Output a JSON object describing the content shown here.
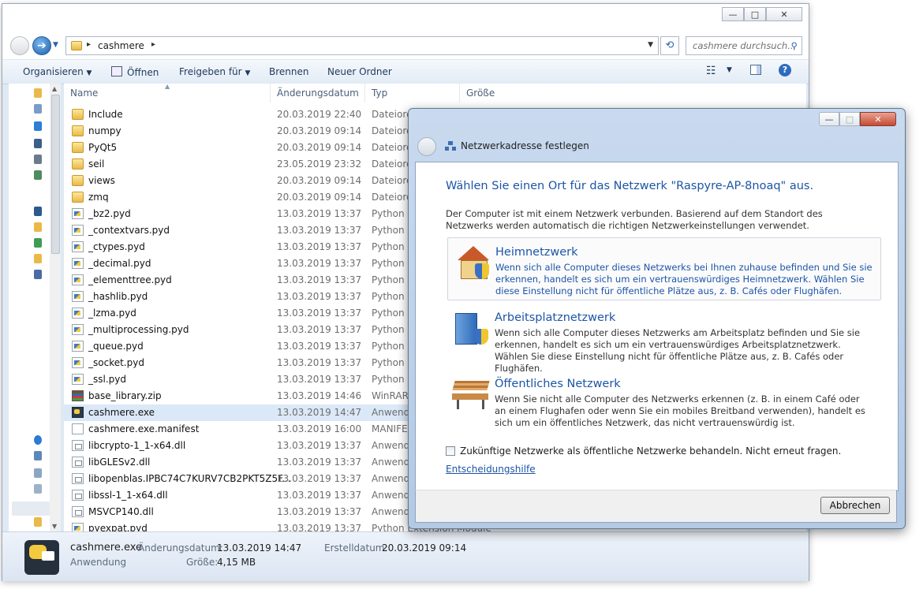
{
  "explorer": {
    "window_buttons": {
      "minimize": "—",
      "maximize": "□",
      "close": "✕"
    },
    "breadcrumb": {
      "arrow": "▸",
      "current": "cashmere"
    },
    "search": {
      "placeholder": "cashmere durchsuch..."
    },
    "toolbar": {
      "organize": "Organisieren",
      "open": "Öffnen",
      "share": "Freigeben für",
      "burn": "Brennen",
      "new_folder": "Neuer Ordner"
    },
    "columns": {
      "name": "Name",
      "date": "Änderungsdatum",
      "type": "Typ",
      "size": "Größe"
    },
    "files": [
      {
        "name": "Include",
        "date": "20.03.2019 22:40",
        "type": "Dateiordner",
        "icon": "folder"
      },
      {
        "name": "numpy",
        "date": "20.03.2019 09:14",
        "type": "Dateiordner",
        "icon": "folder"
      },
      {
        "name": "PyQt5",
        "date": "20.03.2019 09:14",
        "type": "Dateiordner",
        "icon": "folder"
      },
      {
        "name": "seil",
        "date": "23.05.2019 23:32",
        "type": "Dateiordner",
        "icon": "folder"
      },
      {
        "name": "views",
        "date": "20.03.2019 09:14",
        "type": "Dateiordner",
        "icon": "folder"
      },
      {
        "name": "zmq",
        "date": "20.03.2019 09:14",
        "type": "Dateiordner",
        "icon": "folder"
      },
      {
        "name": "_bz2.pyd",
        "date": "13.03.2019 13:37",
        "type": "Python Extension Module",
        "icon": "pyd"
      },
      {
        "name": "_contextvars.pyd",
        "date": "13.03.2019 13:37",
        "type": "Python Extension Module",
        "icon": "pyd"
      },
      {
        "name": "_ctypes.pyd",
        "date": "13.03.2019 13:37",
        "type": "Python Extension Module",
        "icon": "pyd"
      },
      {
        "name": "_decimal.pyd",
        "date": "13.03.2019 13:37",
        "type": "Python Extension Module",
        "icon": "pyd"
      },
      {
        "name": "_elementtree.pyd",
        "date": "13.03.2019 13:37",
        "type": "Python Extension Module",
        "icon": "pyd"
      },
      {
        "name": "_hashlib.pyd",
        "date": "13.03.2019 13:37",
        "type": "Python Extension Module",
        "icon": "pyd"
      },
      {
        "name": "_lzma.pyd",
        "date": "13.03.2019 13:37",
        "type": "Python Extension Module",
        "icon": "pyd"
      },
      {
        "name": "_multiprocessing.pyd",
        "date": "13.03.2019 13:37",
        "type": "Python Extension Module",
        "icon": "pyd"
      },
      {
        "name": "_queue.pyd",
        "date": "13.03.2019 13:37",
        "type": "Python Extension Module",
        "icon": "pyd"
      },
      {
        "name": "_socket.pyd",
        "date": "13.03.2019 13:37",
        "type": "Python Extension Module",
        "icon": "pyd"
      },
      {
        "name": "_ssl.pyd",
        "date": "13.03.2019 13:37",
        "type": "Python Extension Module",
        "icon": "pyd"
      },
      {
        "name": "base_library.zip",
        "date": "13.03.2019 14:46",
        "type": "WinRAR-ZIP-Archiv",
        "icon": "zip"
      },
      {
        "name": "cashmere.exe",
        "date": "13.03.2019 14:47",
        "type": "Anwendung",
        "icon": "exe"
      },
      {
        "name": "cashmere.exe.manifest",
        "date": "13.03.2019 16:00",
        "type": "MANIFEST-Datei",
        "icon": "txt"
      },
      {
        "name": "libcrypto-1_1-x64.dll",
        "date": "13.03.2019 13:37",
        "type": "Anwendungserweiterung",
        "icon": "dll"
      },
      {
        "name": "libGLESv2.dll",
        "date": "13.03.2019 13:37",
        "type": "Anwendungserweiterung",
        "icon": "dll"
      },
      {
        "name": "libopenblas.IPBC74C7KURV7CB2PKT5Z5F...",
        "date": "13.03.2019 13:37",
        "type": "Anwendungserweiterung",
        "icon": "dll"
      },
      {
        "name": "libssl-1_1-x64.dll",
        "date": "13.03.2019 13:37",
        "type": "Anwendungserweiterung",
        "icon": "dll"
      },
      {
        "name": "MSVCP140.dll",
        "date": "13.03.2019 13:37",
        "type": "Anwendungserweiterung",
        "icon": "dll"
      },
      {
        "name": "pyexpat.pyd",
        "date": "13.03.2019 13:37",
        "type": "Python Extension Module",
        "icon": "pyd"
      }
    ],
    "selected_file": "cashmere.exe",
    "details": {
      "name": "cashmere.exe",
      "modified_label": "Änderungsdatum:",
      "modified_value": "13.03.2019 14:47",
      "created_label": "Erstelldatum:",
      "created_value": "20.03.2019 09:14",
      "kind": "Anwendung",
      "size_label": "Größe:",
      "size_value": "4,15 MB"
    }
  },
  "dialog": {
    "title": "Netzwerkadresse festlegen",
    "heading": "Wählen Sie einen Ort für das Netzwerk \"Raspyre-AP-8noaq\" aus.",
    "intro": "Der Computer ist mit einem Netzwerk verbunden. Basierend auf dem Standort des Netzwerks werden automatisch die richtigen Netzwerkeinstellungen verwendet.",
    "options": [
      {
        "title": "Heimnetzwerk",
        "desc": "Wenn sich alle Computer dieses Netzwerks bei Ihnen zuhause befinden und Sie sie erkennen, handelt es sich um ein vertrauenswürdiges Heimnetzwerk. Wählen Sie diese Einstellung nicht für öffentliche Plätze aus, z. B. Cafés oder Flughäfen.",
        "icon": "house-icon"
      },
      {
        "title": "Arbeitsplatznetzwerk",
        "desc": "Wenn sich alle Computer dieses Netzwerks am Arbeitsplatz befinden und Sie sie erkennen, handelt es sich um ein vertrauenswürdiges Arbeitsplatznetzwerk. Wählen Sie diese Einstellung nicht für öffentliche Plätze aus, z. B. Cafés oder Flughäfen.",
        "icon": "office-building-icon"
      },
      {
        "title": "Öffentliches Netzwerk",
        "desc": "Wenn Sie nicht alle Computer des Netzwerks erkennen (z. B. in einem Café oder an einem Flughafen oder wenn Sie ein mobiles Breitband verwenden), handelt es sich um ein öffentliches Netzwerk, das nicht vertrauenswürdig ist.",
        "icon": "park-bench-icon"
      }
    ],
    "checkbox_label": "Zukünftige Netzwerke als öffentliche Netzwerke behandeln. Nicht erneut fragen.",
    "checkbox_checked": false,
    "help_link": "Entscheidungshilfe",
    "cancel": "Abbrechen"
  },
  "colors": {
    "link_blue": "#1c55a6",
    "selection": "#dbe8f7"
  }
}
